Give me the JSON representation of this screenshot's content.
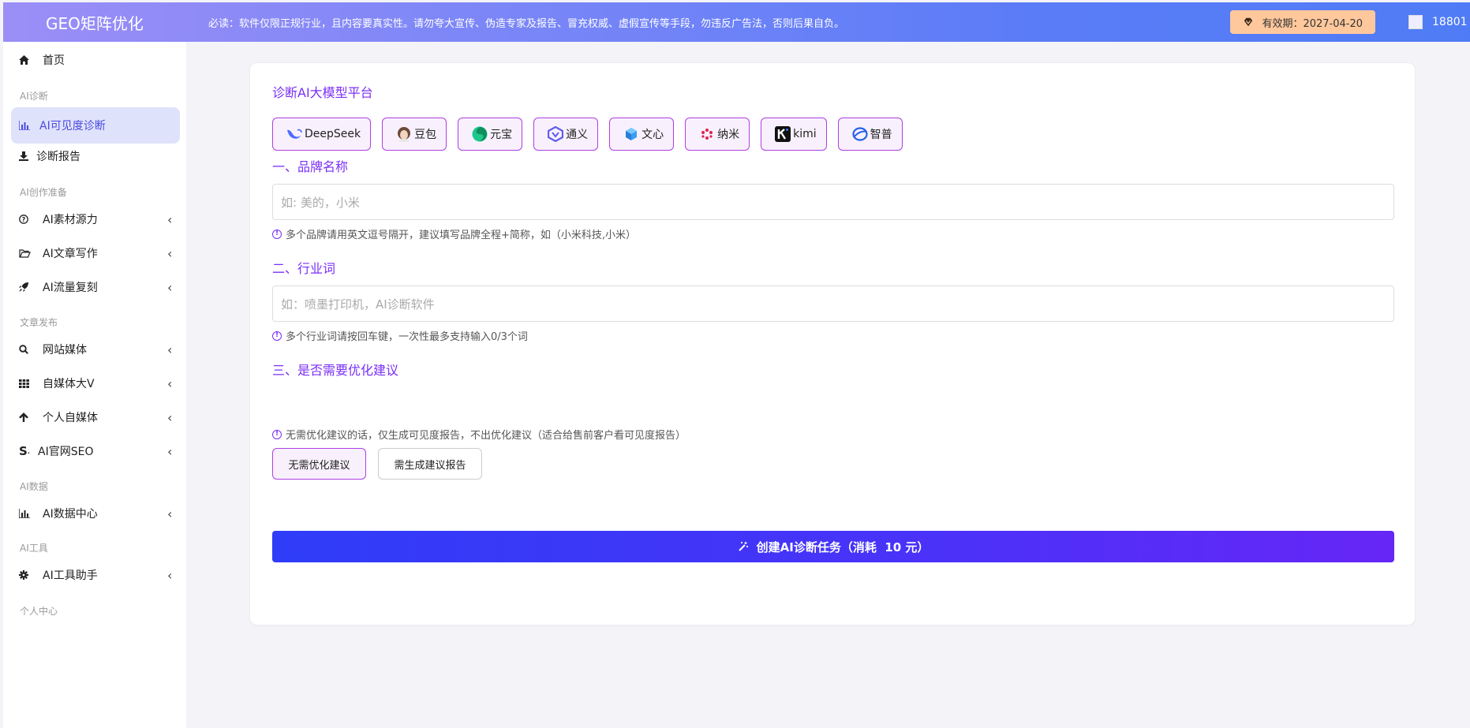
{
  "header": {
    "brand": "GEO矩阵优化",
    "notice": "必读：软件仅限正规行业，且内容要真实性。请勿夸大宣传、伪造专家及报告、冒充权威、虚假宣传等手段，勿违反广告法，否则后果自负。",
    "expiry": "有效期：2027-04-20",
    "user": "18801"
  },
  "sidebar": {
    "home": "首页",
    "sections": {
      "diag": "AI诊断",
      "create": "AI创作准备",
      "publish": "文章发布",
      "data": "AI数据",
      "tools": "AI工具",
      "personal": "个人中心"
    },
    "items": {
      "visibility": "AI可见度诊断",
      "report": "诊断报告",
      "material": "AI素材源力",
      "writing": "AI文章写作",
      "traffic": "AI流量复刻",
      "website": "网站媒体",
      "bigv": "自媒体大V",
      "personal_media": "个人自媒体",
      "seo": "AI官网SEO",
      "datacenter": "AI数据中心",
      "assistant": "AI工具助手"
    }
  },
  "main": {
    "platform_title": "诊断AI大模型平台",
    "platforms": [
      "DeepSeek",
      "豆包",
      "元宝",
      "通义",
      "文心",
      "纳米",
      "kimi",
      "智普"
    ],
    "brand_title": "一、品牌名称",
    "brand_placeholder": "如: 美的，小米",
    "brand_hint": "多个品牌请用英文逗号隔开，建议填写品牌全程+简称，如（小米科技,小米）",
    "industry_title": "二、行业词",
    "industry_placeholder": "如：喷墨打印机，AI诊断软件",
    "industry_hint": "多个行业词请按回车键，一次性最多支持输入0/3个词",
    "suggest_title": "三、是否需要优化建议",
    "opt_no": "无需优化建议",
    "opt_yes": "需生成建议报告",
    "suggest_hint": "无需优化建议的话，仅生成可见度报告，不出优化建议（适合给售前客户看可见度报告）",
    "create_button": "创建AI诊断任务（消耗  10 元）"
  }
}
